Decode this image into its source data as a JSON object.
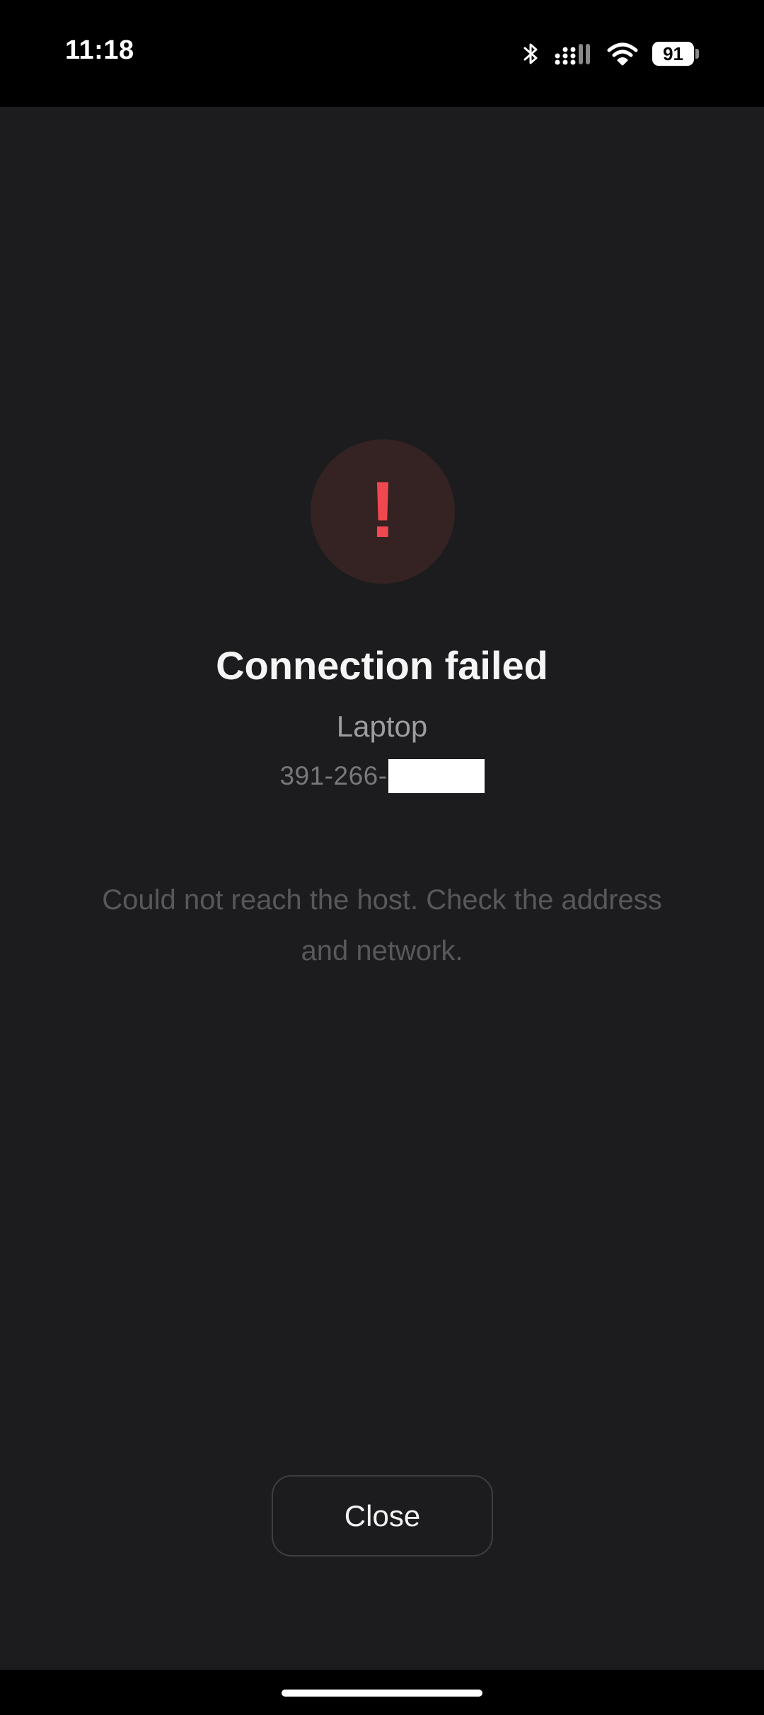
{
  "status_bar": {
    "time": "11:18",
    "battery_level": "91",
    "icons": [
      "bluetooth-icon",
      "cellular-signal-icon",
      "wifi-icon",
      "battery-icon"
    ]
  },
  "dialog": {
    "icon": "exclamation-icon",
    "icon_glyph": "!",
    "title": "Connection failed",
    "host_name": "Laptop",
    "host_id": "391-266-",
    "message": "Could not reach the host. Check the address and network.",
    "close_label": "Close"
  },
  "colors": {
    "background": "#1c1c1e",
    "alert_red": "#f0484f",
    "alert_circle": "#352222"
  }
}
